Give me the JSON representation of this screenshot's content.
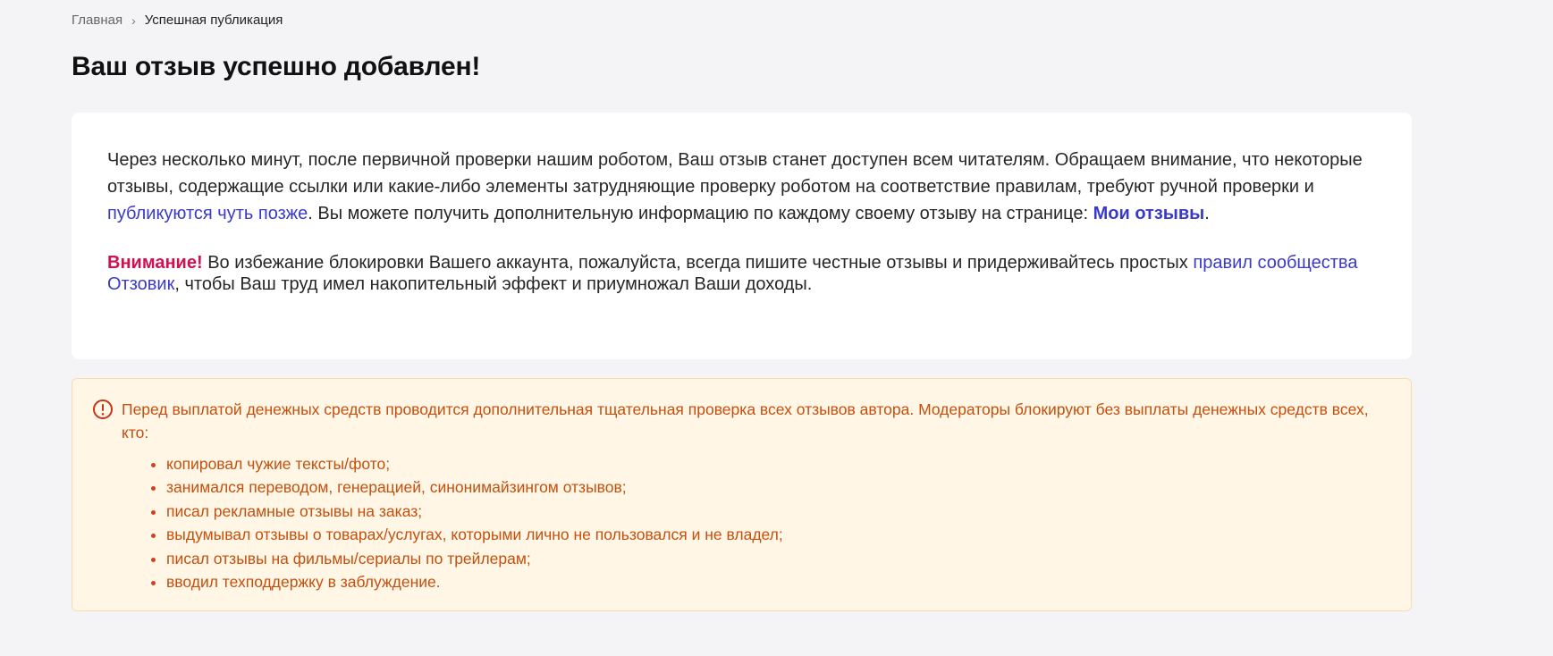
{
  "breadcrumb": {
    "home": "Главная",
    "separator": "›",
    "current": "Успешная публикация"
  },
  "title": "Ваш отзыв успешно добавлен!",
  "info": {
    "p1_text1": "Через несколько минут, после первичной проверки нашим роботом, Ваш отзыв станет доступен всем читателям. Обращаем внимание, что некоторые отзывы, содержащие ссылки или какие-либо элементы затрудняющие проверку роботом на соответствие правилам, требуют ручной проверки и ",
    "p1_link": "публикуются чуть позже",
    "p1_text2": ". Вы можете получить дополнительную информацию по каждому своему отзыву на странице: ",
    "my_reviews_link": "Мои отзывы",
    "p1_end": ".",
    "attention": "Внимание!",
    "p2_text1": " Во избежание блокировки Вашего аккаунта, пожалуйста, всегда пишите честные отзывы и придерживайтесь простых ",
    "rules_link": "правил сообщества Отзовик",
    "p2_text2": ", чтобы Ваш труд имел накопительный эффект и приумножал Ваши доходы."
  },
  "notice": {
    "icon": "exclamation-circle-icon",
    "text": "Перед выплатой денежных средств проводится дополнительная тщательная проверка всех отзывов автора. Модераторы блокируют без выплаты денежных средств всех, кто:",
    "items": [
      "копировал чужие тексты/фото;",
      "занимался переводом, генерацией, синонимайзингом отзывов;",
      "писал рекламные отзывы на заказ;",
      "выдумывал отзывы о товарах/услугах, которыми лично не пользовался и не владел;",
      "писал отзывы на фильмы/сериалы по трейлерам;",
      "вводил техподдержку в заблуждение."
    ]
  },
  "colors": {
    "background": "#f4f4f6",
    "link": "#3a3ac8",
    "attention": "#d0114f",
    "notice_text": "#c4500f",
    "notice_bg": "#fff6e5"
  }
}
